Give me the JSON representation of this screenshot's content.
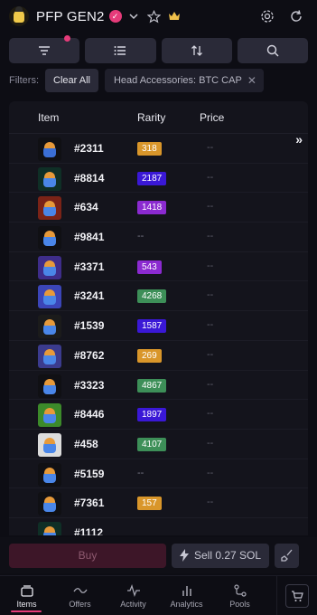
{
  "header": {
    "title": "PFP GEN2",
    "icons": [
      "collection-logo-icon",
      "verified-icon",
      "chevron-down-icon",
      "star-icon",
      "crown-icon",
      "gear-icon",
      "refresh-icon"
    ]
  },
  "toolbar": {
    "buttons": [
      "filter-icon",
      "list-view-icon",
      "sort-icon",
      "search-icon"
    ]
  },
  "filters": {
    "label": "Filters:",
    "clear_label": "Clear All",
    "chip_label": "Head Accessories: BTC CAP"
  },
  "table": {
    "columns": {
      "item": "Item",
      "rarity": "Rarity",
      "price": "Price"
    },
    "expand_label": "»",
    "rows": [
      {
        "name": "#2311",
        "rarity": "318",
        "rarity_color": "#d9962a",
        "price": "--",
        "bg": "#101014",
        "face": "#3b6fd6"
      },
      {
        "name": "#8814",
        "rarity": "2187",
        "rarity_color": "#3a18d6",
        "price": "--",
        "bg": "#0f2f26",
        "face": "#4a86e8"
      },
      {
        "name": "#634",
        "rarity": "1418",
        "rarity_color": "#8b2ad0",
        "price": "--",
        "bg": "#7a2317",
        "face": "#4a86e8"
      },
      {
        "name": "#9841",
        "rarity": "--",
        "rarity_color": "",
        "price": "--",
        "bg": "#101014",
        "face": "#4a86e8"
      },
      {
        "name": "#3371",
        "rarity": "543",
        "rarity_color": "#8b2ad0",
        "price": "--",
        "bg": "#3e2d8a",
        "face": "#4a86e8"
      },
      {
        "name": "#3241",
        "rarity": "4268",
        "rarity_color": "#3d8f58",
        "price": "--",
        "bg": "#3b45b8",
        "face": "#4a86e8"
      },
      {
        "name": "#1539",
        "rarity": "1587",
        "rarity_color": "#3a18d6",
        "price": "--",
        "bg": "#1b1b1b",
        "face": "#4a86e8"
      },
      {
        "name": "#8762",
        "rarity": "269",
        "rarity_color": "#d9962a",
        "price": "--",
        "bg": "#3b3b8e",
        "face": "#4a86e8"
      },
      {
        "name": "#3323",
        "rarity": "4867",
        "rarity_color": "#3d8f58",
        "price": "--",
        "bg": "#101014",
        "face": "#4a86e8"
      },
      {
        "name": "#8446",
        "rarity": "1897",
        "rarity_color": "#3a18d6",
        "price": "--",
        "bg": "#3c8a2a",
        "face": "#4a86e8"
      },
      {
        "name": "#458",
        "rarity": "4107",
        "rarity_color": "#3d8f58",
        "price": "--",
        "bg": "#dcdcdc",
        "face": "#4a86e8"
      },
      {
        "name": "#5159",
        "rarity": "--",
        "rarity_color": "",
        "price": "--",
        "bg": "#101014",
        "face": "#4a86e8"
      },
      {
        "name": "#7361",
        "rarity": "157",
        "rarity_color": "#d9962a",
        "price": "--",
        "bg": "#101014",
        "face": "#4a86e8"
      },
      {
        "name": "#1112",
        "rarity": "",
        "rarity_color": "",
        "price": "",
        "bg": "#0f2f26",
        "face": "#4a86e8"
      }
    ]
  },
  "actions": {
    "buy_label": "Buy",
    "sell_label": "Sell 0.27 SOL"
  },
  "nav": {
    "items": [
      {
        "label": "Items",
        "icon": "items-icon"
      },
      {
        "label": "Offers",
        "icon": "offers-icon"
      },
      {
        "label": "Activity",
        "icon": "activity-icon"
      },
      {
        "label": "Analytics",
        "icon": "analytics-icon"
      },
      {
        "label": "Pools",
        "icon": "pools-icon"
      }
    ]
  },
  "colors": {
    "accent": "#e63b7a",
    "background": "#0d0d14",
    "panel": "#14141c",
    "button": "#2a2a38"
  }
}
